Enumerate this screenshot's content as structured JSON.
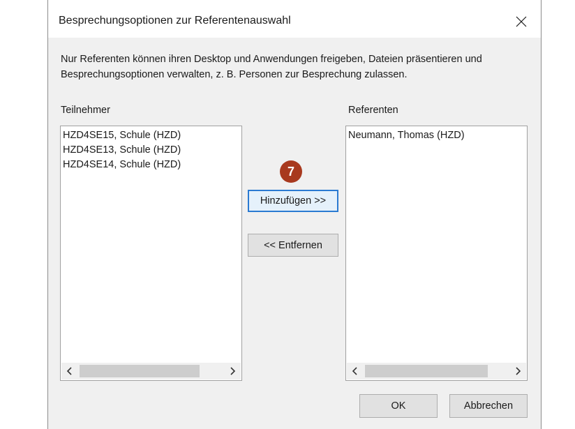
{
  "dialog": {
    "title": "Besprechungsoptionen zur Referentenauswahl",
    "description": "Nur Referenten können ihren Desktop und Anwendungen freigeben, Dateien präsentieren und Besprechungsoptionen verwalten, z. B. Personen zur Besprechung zulassen."
  },
  "participants": {
    "label": "Teilnehmer",
    "items": [
      "HZD4SE15, Schule (HZD)",
      "HZD4SE13, Schule (HZD)",
      "HZD4SE14, Schule (HZD)"
    ]
  },
  "presenters": {
    "label": "Referenten",
    "items": [
      "Neumann, Thomas (HZD)"
    ]
  },
  "buttons": {
    "add": "Hinzufügen >>",
    "remove": "<< Entfernen",
    "ok": "OK",
    "cancel": "Abbrechen"
  },
  "annotation": {
    "step_number": "7",
    "color": "#a8391e"
  },
  "colors": {
    "dialog_bg": "#f0f0f0",
    "focus_border": "#2a7ad2"
  },
  "icons": {
    "close": "close-icon",
    "scroll_left": "chevron-left-icon",
    "scroll_right": "chevron-right-icon"
  }
}
